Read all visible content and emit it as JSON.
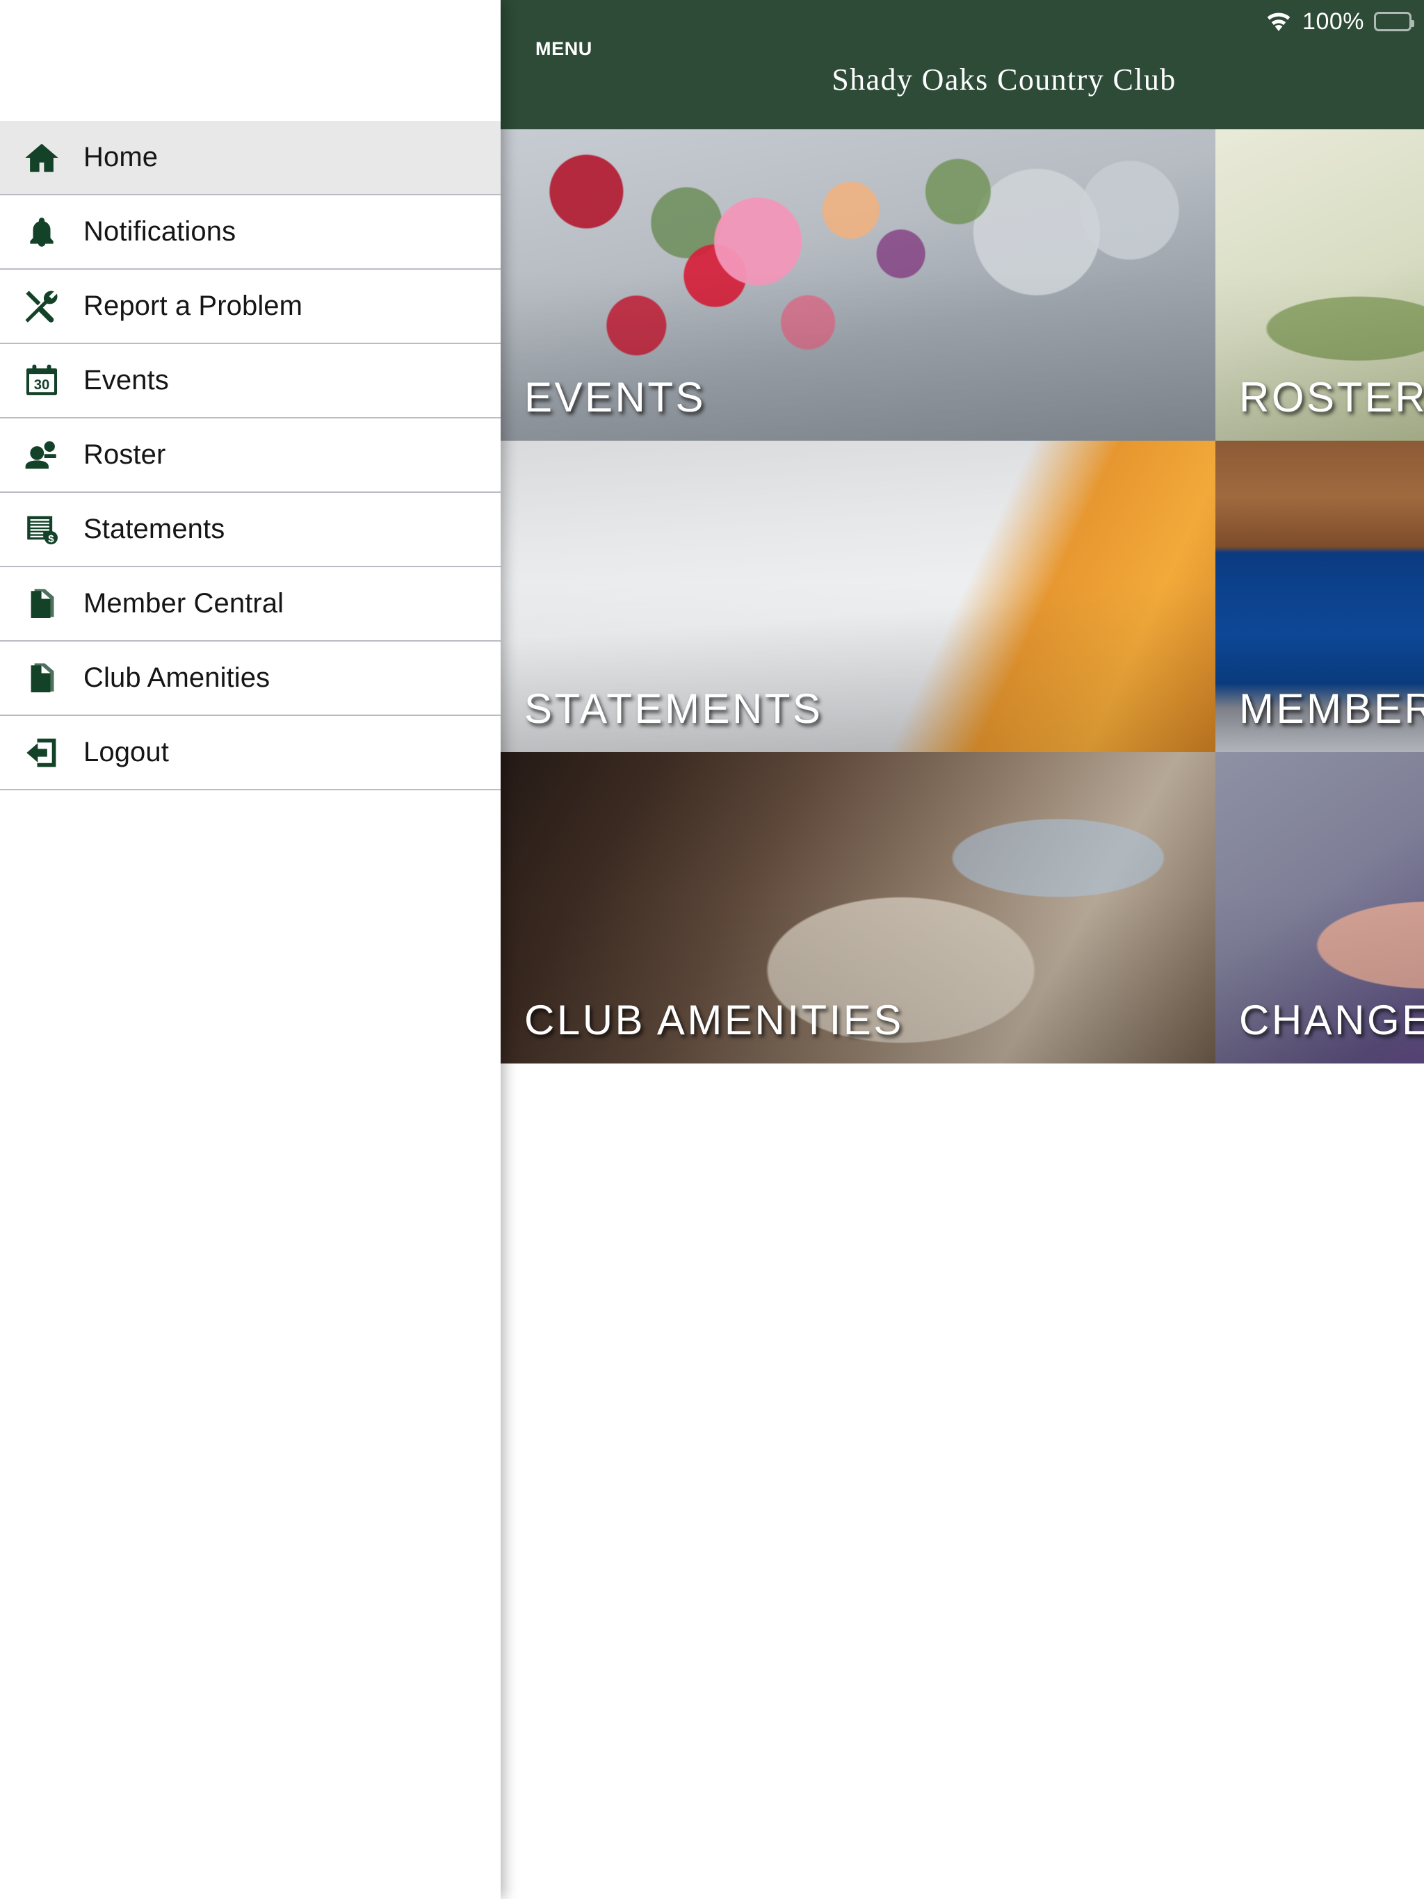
{
  "sidebar": {
    "items": [
      {
        "label": "Home",
        "icon": "home-icon",
        "active": true
      },
      {
        "label": "Notifications",
        "icon": "bell-icon",
        "active": false
      },
      {
        "label": "Report a Problem",
        "icon": "tools-icon",
        "active": false
      },
      {
        "label": "Events",
        "icon": "calendar-icon",
        "active": false
      },
      {
        "label": "Roster",
        "icon": "people-icon",
        "active": false
      },
      {
        "label": "Statements",
        "icon": "invoice-icon",
        "active": false
      },
      {
        "label": "Member Central",
        "icon": "documents-icon",
        "active": false
      },
      {
        "label": "Club Amenities",
        "icon": "documents-icon",
        "active": false
      },
      {
        "label": "Logout",
        "icon": "logout-icon",
        "active": false
      }
    ]
  },
  "statusbar": {
    "wifi_icon": "wifi-icon",
    "battery_percent": "100%",
    "battery_icon": "battery-full-icon"
  },
  "header": {
    "menu_label": "MENU",
    "menu_icon": "hamburger-icon",
    "title": "Shady Oaks Country Club",
    "background_color": "#2d4b37"
  },
  "tiles": [
    {
      "caption": "EVENTS",
      "photo": "ph-events"
    },
    {
      "caption": "ROSTER",
      "photo": "ph-roster"
    },
    {
      "caption": "STATEMENTS",
      "photo": "ph-statements"
    },
    {
      "caption": "MEMBER CENTRAL",
      "photo": "ph-member"
    },
    {
      "caption": "CLUB AMENITIES",
      "photo": "ph-amenities"
    },
    {
      "caption": "CHANGE PASSWORD",
      "photo": "ph-change"
    }
  ]
}
